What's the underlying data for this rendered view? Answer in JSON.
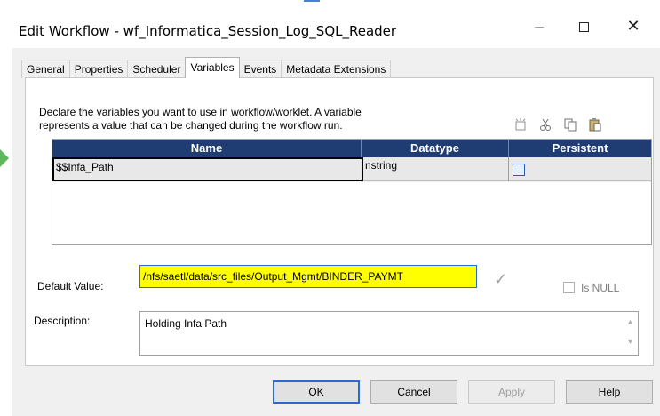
{
  "window": {
    "title": "Edit Workflow - wf_Informatica_Session_Log_SQL_Reader",
    "minimize_label": "—",
    "maximize_label": "□",
    "close_label": "✕"
  },
  "tabs": [
    {
      "label": "General"
    },
    {
      "label": "Properties"
    },
    {
      "label": "Scheduler"
    },
    {
      "label": "Variables",
      "active": true
    },
    {
      "label": "Events"
    },
    {
      "label": "Metadata Extensions"
    }
  ],
  "variables_tab": {
    "description_line1": "Declare the variables you want to use in workflow/worklet.  A variable",
    "description_line2": "represents a value that can be changed during the workflow run.",
    "toolbar": {
      "new_icon": "new-row-icon",
      "cut_icon": "cut-icon",
      "copy_icon": "copy-icon",
      "paste_icon": "paste-icon"
    },
    "grid": {
      "columns": [
        "Name",
        "Datatype",
        "Persistent"
      ],
      "rows": [
        {
          "name": "$$Infa_Path",
          "datatype": "nstring",
          "persistent": false
        }
      ]
    },
    "default_value_label": "Default Value:",
    "default_value": "/nfs/saetl/data/src_files/Output_Mgmt/BINDER_PAYMT",
    "is_null_label": "Is NULL",
    "is_null_checked": false,
    "description_label": "Description:",
    "description_value": "Holding Infa Path"
  },
  "buttons": {
    "ok": "OK",
    "cancel": "Cancel",
    "apply": "Apply",
    "help": "Help"
  },
  "colors": {
    "grid_header": "#1f3d73",
    "highlight": "#ffff00",
    "focus_border": "#2a6ad0"
  }
}
